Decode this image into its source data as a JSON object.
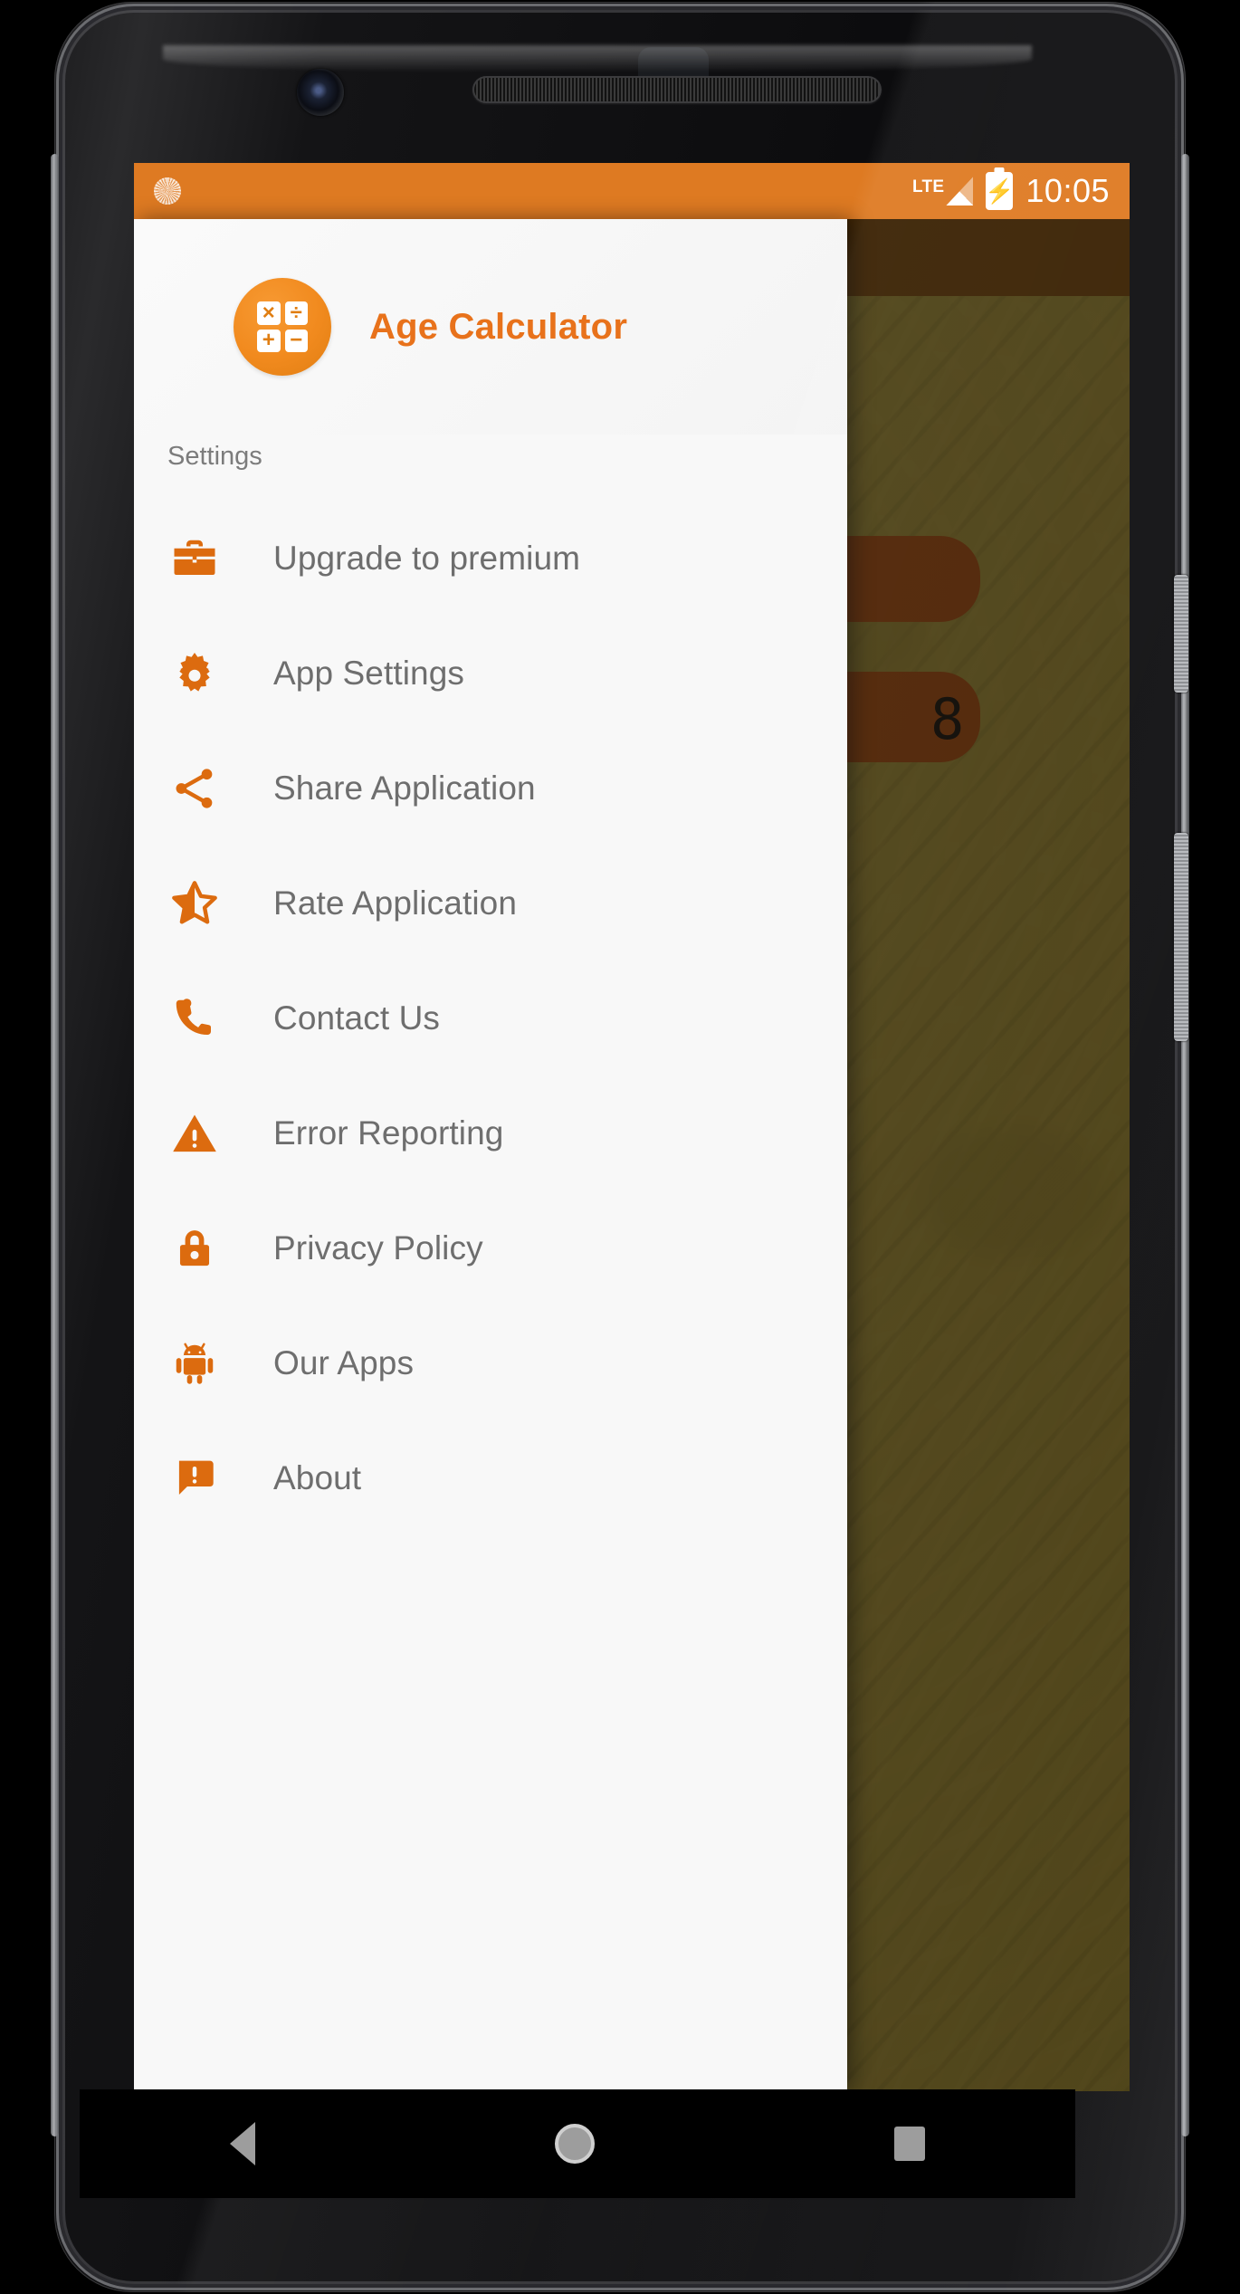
{
  "statusbar": {
    "sync_icon": "sync-icon",
    "network_label": "LTE",
    "signal_icon": "signal-bars-icon",
    "battery_icon": "battery-charging-icon",
    "battery_bolt": "⚡",
    "time": "10:05"
  },
  "drawer": {
    "logo_icon": "calculator-logo-icon",
    "logo_keys": [
      "×",
      "÷",
      "+",
      "−"
    ],
    "app_title": "Age Calculator",
    "section_label": "Settings",
    "items": [
      {
        "label": "Upgrade to premium",
        "icon": "briefcase-icon"
      },
      {
        "label": "App Settings",
        "icon": "gear-icon"
      },
      {
        "label": "Share Application",
        "icon": "share-icon"
      },
      {
        "label": "Rate Application",
        "icon": "star-half-icon"
      },
      {
        "label": "Contact Us",
        "icon": "phone-icon"
      },
      {
        "label": "Error Reporting",
        "icon": "warning-triangle-icon"
      },
      {
        "label": "Privacy Policy",
        "icon": "lock-icon"
      },
      {
        "label": "Our Apps",
        "icon": "android-robot-icon"
      },
      {
        "label": "About",
        "icon": "announcement-icon"
      }
    ]
  },
  "background_app": {
    "display_digit": "8"
  },
  "navbar": {
    "back": "back-triangle-icon",
    "home": "home-circle-icon",
    "recents": "recents-square-icon"
  },
  "colors": {
    "status_bar": "#DE7A22",
    "accent_orange": "#DC6B0F",
    "title_orange": "#E8721B",
    "drawer_bg": "#F8F8F8",
    "label_gray": "#6E6E6E",
    "section_gray": "#7C7C7C"
  }
}
